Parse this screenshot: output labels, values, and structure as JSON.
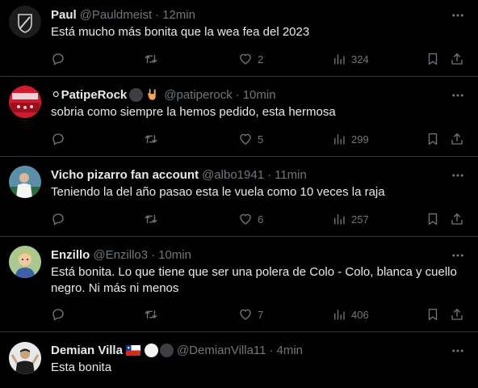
{
  "tweets": [
    {
      "name": "Paul",
      "handle": "@Pauldmeist",
      "time": "12min",
      "text": "Está mucho más bonita que la wea fea del 2023",
      "likes": "2",
      "views": "324",
      "avatar_icon": "colo-colo-crest-avatar",
      "avatar_color": "#1a1a1a"
    },
    {
      "name": "⚪PatipeRock",
      "handle": "@patiperock",
      "time": "10min",
      "text": "sobria como siempre la hemos pedido, esta hermosa",
      "likes": "5",
      "views": "299",
      "avatar_icon": "stadium-fans-avatar",
      "avatar_color": "#c0152a"
    },
    {
      "name": "Vicho pizarro fan account",
      "handle": "@albo1941",
      "time": "11min",
      "text": "Teniendo la del año pasao esta le vuela como 10 veces la raja",
      "likes": "6",
      "views": "257",
      "avatar_icon": "player-photo-avatar",
      "avatar_color": "#3a6e8a"
    },
    {
      "name": "Enzillo",
      "handle": "@Enzillo3",
      "time": "10min",
      "text": "Está bonita. Lo que tiene que ser una polera de Colo - Colo, blanca y cuello negro. Ni más ni menos",
      "likes": "7",
      "views": "406",
      "avatar_icon": "cartoon-avatar",
      "avatar_color": "#8fb87a"
    },
    {
      "name": "Demian Villa",
      "handle": "@DemianVilla11",
      "time": "4min",
      "text": "Esta bonita",
      "avatar_icon": "player-celebration-avatar",
      "avatar_color": "#dddddd"
    }
  ],
  "separator": "·",
  "colors": {
    "background": "#000000",
    "text": "#e7e9ea",
    "muted": "#71767b",
    "divider": "#2f3336"
  }
}
